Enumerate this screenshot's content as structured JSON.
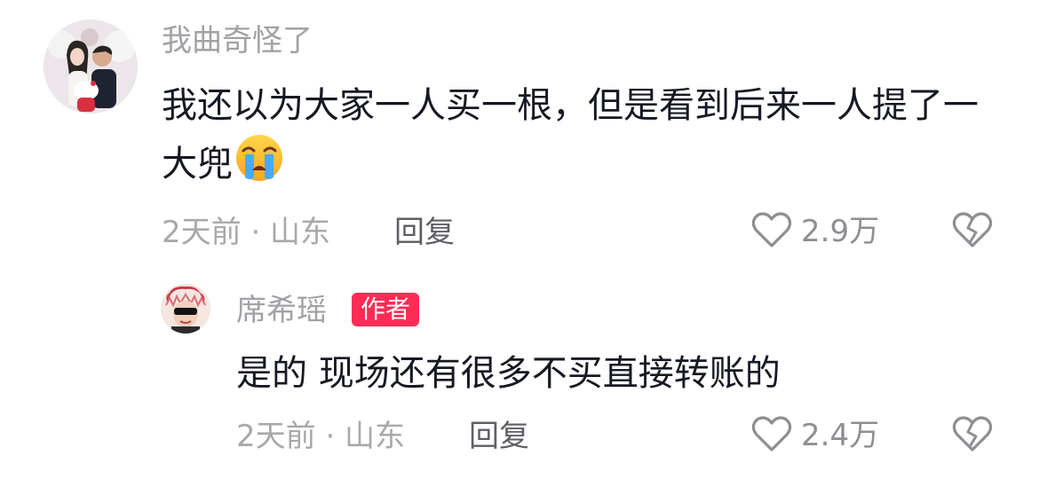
{
  "comments": [
    {
      "username": "我曲奇怪了",
      "text": "我还以为大家一人买一根，但是看到后来一人提了一大兜",
      "emoji": "loudly-crying-face",
      "time_location": "2天前 · 山东",
      "reply_label": "回复",
      "likes": "2.9万",
      "avatar": "avatar-photo-couple",
      "icons": {
        "like": "heart-outline-icon",
        "dislike": "broken-heart-icon"
      }
    }
  ],
  "replies": [
    {
      "username": "席希瑶",
      "badge": "作者",
      "text": "是的 现场还有很多不买直接转账的",
      "time_location": "2天前 · 山东",
      "reply_label": "回复",
      "likes": "2.4万",
      "avatar": "avatar-photo-sunglasses"
    }
  ],
  "colors": {
    "badge_bg": "#fe2c55",
    "text_primary": "#161823",
    "text_secondary": "#a1a1a6"
  }
}
